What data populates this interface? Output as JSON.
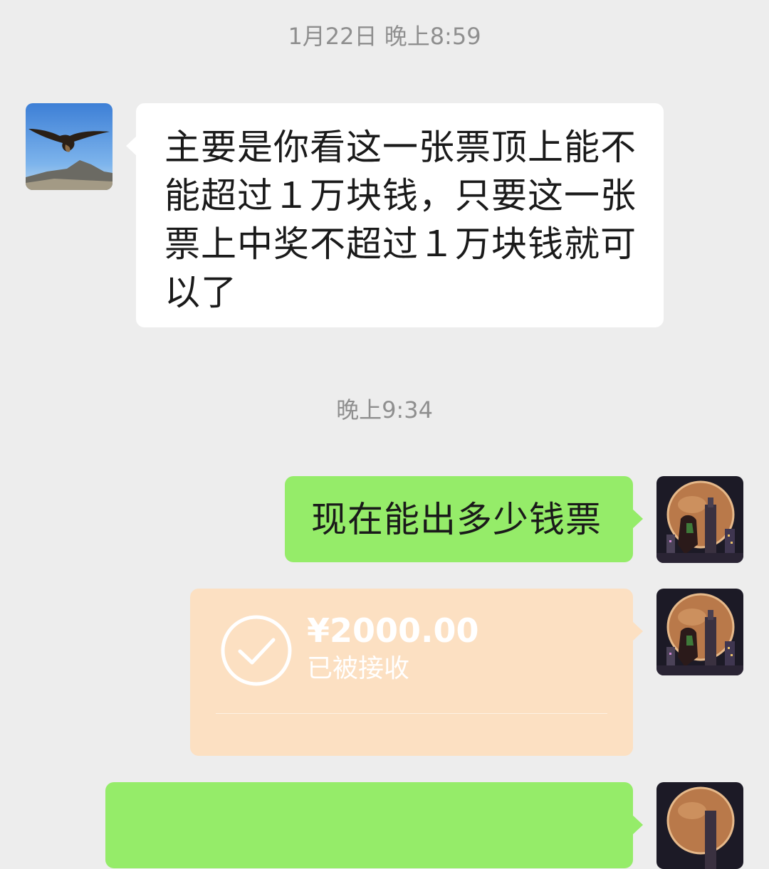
{
  "chat": {
    "timestamp_1": "1月22日 晚上8:59",
    "timestamp_2": "晚上9:34",
    "messages": [
      {
        "side": "left",
        "avatar": "eagle-avatar",
        "text": "主要是你看这一张票顶上能不能超过１万块钱，只要这一张票上中奖不超过１万块钱就可以了"
      },
      {
        "side": "right",
        "avatar": "moon-city-avatar",
        "text": "现在能出多少钱票"
      },
      {
        "side": "right",
        "type": "transfer",
        "avatar": "moon-city-avatar",
        "amount": "¥2000.00",
        "status": "已被接收",
        "icon": "check-circle-icon"
      },
      {
        "side": "right",
        "avatar": "moon-city-avatar",
        "text": ""
      }
    ]
  },
  "colors": {
    "background": "#ededed",
    "incoming_bubble": "#ffffff",
    "outgoing_bubble": "#95ec69",
    "transfer_bubble": "#fce0c2",
    "timestamp": "#8f8f8f"
  }
}
